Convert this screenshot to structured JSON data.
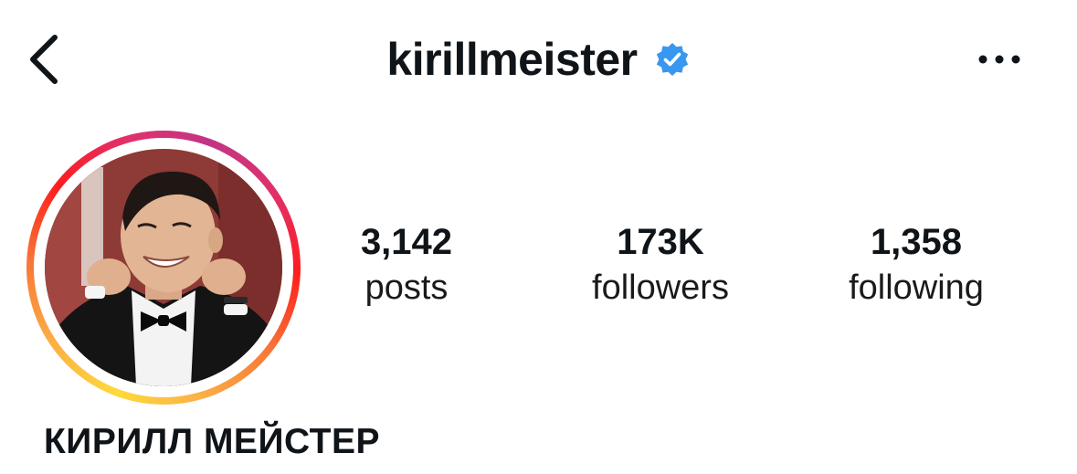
{
  "header": {
    "username": "kirillmeister",
    "verified": true,
    "back_icon": "chevron-left-icon",
    "more_icon": "more-horizontal-icon",
    "verified_icon": "verified-badge-icon",
    "verified_color": "#3897f0"
  },
  "profile": {
    "display_name": "КИРИЛЛ МЕЙСТЕР",
    "avatar_story_ring": true
  },
  "stats": {
    "posts": {
      "count": "3,142",
      "label": "posts"
    },
    "followers": {
      "count": "173K",
      "label": "followers"
    },
    "following": {
      "count": "1,358",
      "label": "following"
    }
  }
}
